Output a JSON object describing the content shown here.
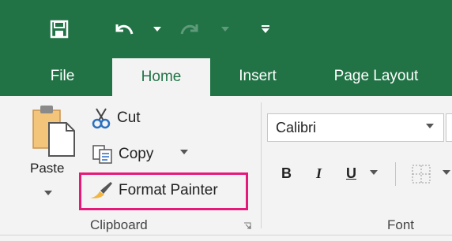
{
  "quick_access": {
    "save_icon": "save-icon",
    "undo_icon": "undo-icon",
    "redo_icon": "redo-icon",
    "customize_icon": "customize-qat-icon"
  },
  "tabs": [
    {
      "label": "File",
      "active": false
    },
    {
      "label": "Home",
      "active": true
    },
    {
      "label": "Insert",
      "active": false
    },
    {
      "label": "Page Layout",
      "active": false
    }
  ],
  "clipboard": {
    "paste_label": "Paste",
    "cut_label": "Cut",
    "copy_label": "Copy",
    "format_painter_label": "Format Painter",
    "group_label": "Clipboard"
  },
  "font": {
    "font_name": "Calibri",
    "bold_label": "B",
    "italic_label": "I",
    "underline_label": "U",
    "group_label": "Font"
  },
  "colors": {
    "ribbon_green": "#217346",
    "highlight_pink": "#e6197a",
    "ribbon_bg": "#f3f3f3"
  }
}
